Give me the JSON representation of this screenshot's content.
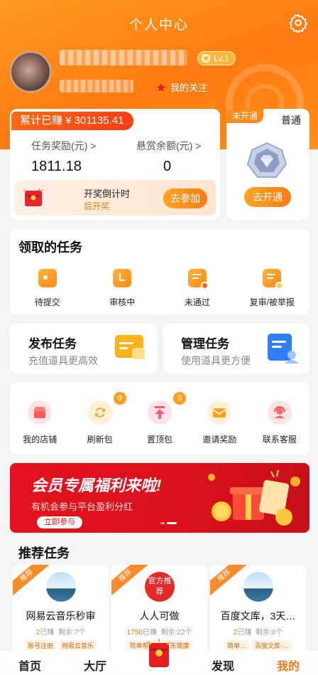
{
  "header": {
    "title": "个人中心"
  },
  "profile": {
    "level": "Lv.1",
    "follow_label": "我的关注"
  },
  "earnings": {
    "total_label": "累计已赚 ¥ 301135.41",
    "task_reward_label": "任务奖励(元) >",
    "task_reward_value": "1811.18",
    "bounty_label": "悬赏余额(元) >",
    "bounty_value": "0",
    "lottery_title": "开奖倒计时",
    "lottery_sub": "后开奖",
    "join_button": "去参加"
  },
  "vip": {
    "tag": "未开通",
    "title": "普通",
    "open_button": "去开通"
  },
  "claimed_tasks": {
    "title": "领取的任务",
    "items": [
      {
        "label": "待提交",
        "icon": "pending-submit-icon"
      },
      {
        "label": "审核中",
        "icon": "reviewing-icon"
      },
      {
        "label": "未通过",
        "icon": "rejected-icon"
      },
      {
        "label": "复审/被举报",
        "icon": "re-review-icon"
      }
    ]
  },
  "publish": {
    "title": "发布任务",
    "subtitle": "充值道具更高效"
  },
  "manage": {
    "title": "管理任务",
    "subtitle": "使用道具更方便"
  },
  "services": {
    "items": [
      {
        "label": "我的店铺",
        "icon": "shop-icon",
        "badge": ""
      },
      {
        "label": "刷新包",
        "icon": "refresh-icon",
        "badge": "0"
      },
      {
        "label": "置顶包",
        "icon": "pin-top-icon",
        "badge": "0"
      },
      {
        "label": "邀请奖励",
        "icon": "invite-icon",
        "badge": ""
      },
      {
        "label": "联系客服",
        "icon": "support-icon",
        "badge": ""
      }
    ]
  },
  "banner": {
    "title": "会员专属福利来啦!",
    "subtitle": "有机会参与平台盈利分红",
    "button": "立即参与"
  },
  "recommend": {
    "title": "推荐任务",
    "cards": [
      {
        "ribbon": "推荐",
        "title": "网易云音乐秒审",
        "done": "2",
        "done_suffix": "已赚",
        "remain": "剩余:7个",
        "tags": [
          "账号注册",
          "网易云音乐"
        ]
      },
      {
        "ribbon": "推荐",
        "title": "人人可做",
        "official": "官方推荐",
        "done": "1750",
        "done_suffix": "已赚",
        "remain": "剩余:22个",
        "tags": [
          "简单帮忙",
          "京东健康"
        ]
      },
      {
        "ribbon": "推荐",
        "title": "百度文库，3天…",
        "done": "2",
        "done_suffix": "已赚",
        "remain": "剩余:8个",
        "tags": [
          "简单…",
          "百度文库-…"
        ]
      }
    ]
  },
  "tabbar": {
    "home": "首页",
    "hall": "大厅",
    "discover": "发现",
    "mine": "我的"
  },
  "colors": {
    "accent": "#ff7614",
    "banner": "#e3131e"
  }
}
